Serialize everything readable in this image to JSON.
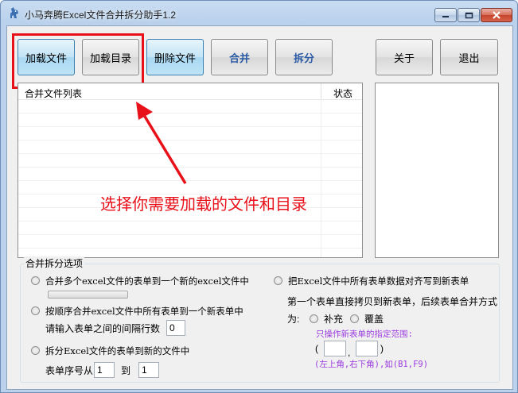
{
  "window": {
    "title": "小马奔腾Excel文件合并拆分助手1.2",
    "min_icon": "minimize-icon",
    "max_icon": "maximize-icon",
    "close_icon": "close-icon",
    "app_icon": "horse-app-icon"
  },
  "toolbar": {
    "load_file": "加载文件",
    "load_dir": "加载目录",
    "delete_file": "删除文件",
    "merge": "合并",
    "split": "拆分",
    "about": "关于",
    "exit": "退出"
  },
  "file_list": {
    "col_name": "合并文件列表",
    "col_status": "状态",
    "rows": []
  },
  "annotation": {
    "text": "选择你需要加载的文件和目录",
    "color": "#e8111a"
  },
  "options": {
    "title": "合并拆分选项",
    "merge_multi": "合并多个excel文件的表单到一个新的excel文件中",
    "progress": 0,
    "merge_sequential": "按顺序合并excel文件中所有表单到一个新表单中",
    "interval_label": "请输入表单之间的间隔行数",
    "interval_value": "0",
    "split_excel": "拆分Excel文件的表单到新的文件中",
    "sheet_range_from_label": "表单序号从",
    "sheet_from": "1",
    "sheet_range_to_label": "到",
    "sheet_to": "1",
    "align_write": "把Excel文件中所有表单数据对齐写到新表单",
    "align_desc": "第一个表单直接拷贝到新表单，后续表单合并方式",
    "mode_label": "为:",
    "mode_append": "补充",
    "mode_overwrite": "覆盖",
    "range_note": "只操作新表单的指定范围:",
    "paren_open": "(",
    "comma": ",",
    "paren_close": ")",
    "range_example": "(左上角,右下角),如(B1,F9)",
    "accent_color": "#9b3be0"
  }
}
